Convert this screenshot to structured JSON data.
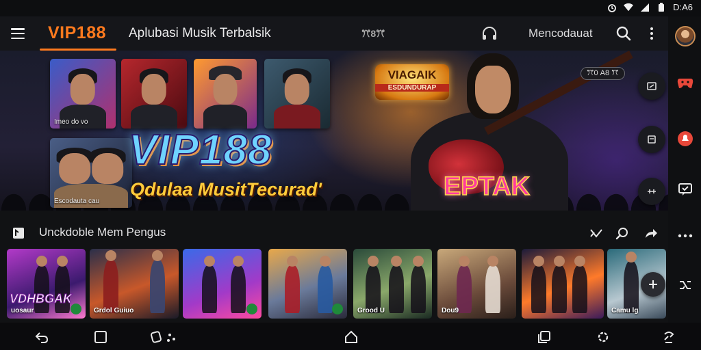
{
  "status": {
    "time": "D:A6"
  },
  "appbar": {
    "logo": "VIP188",
    "title": "Aplubasi Musik Terbalsik",
    "center_mark": "ꔫ8ꔫ",
    "user": "Mencodauat"
  },
  "hero": {
    "thumbs": [
      {
        "label": "Imeo do vo"
      },
      {
        "label": ""
      },
      {
        "label": ""
      },
      {
        "label": ""
      },
      {
        "label": "Escodauta cau"
      }
    ],
    "title": "VIP188",
    "subtitle": "Qdulaa MusitTecurad'",
    "badge_top": "VIAGAIK",
    "badge_bottom": "ESDUNDURAP",
    "tag": "EPTAK",
    "corner_tag": "ꔫ0 A8 ꔫ"
  },
  "section": {
    "title": "Unckdoble Mem Pengus",
    "cards": [
      {
        "big": "VDHBGAK",
        "label": "uosaur"
      },
      {
        "big": "",
        "label": "Grdol   Guiuo"
      },
      {
        "big": "",
        "label": ""
      },
      {
        "big": "",
        "label": ""
      },
      {
        "big": "",
        "label": "Grood U"
      },
      {
        "big": "",
        "label": "Dou9"
      },
      {
        "big": "",
        "label": ""
      },
      {
        "big": "",
        "label": "Camu lg"
      }
    ]
  },
  "colors": {
    "accent": "#ff7a1e",
    "background": "#111214",
    "appbar": "#15161a"
  },
  "icons": [
    "menu-icon",
    "search-icon",
    "more-vertical-icon",
    "back-icon",
    "home-icon",
    "recents-icon",
    "add-icon",
    "share-icon",
    "refresh-icon"
  ]
}
